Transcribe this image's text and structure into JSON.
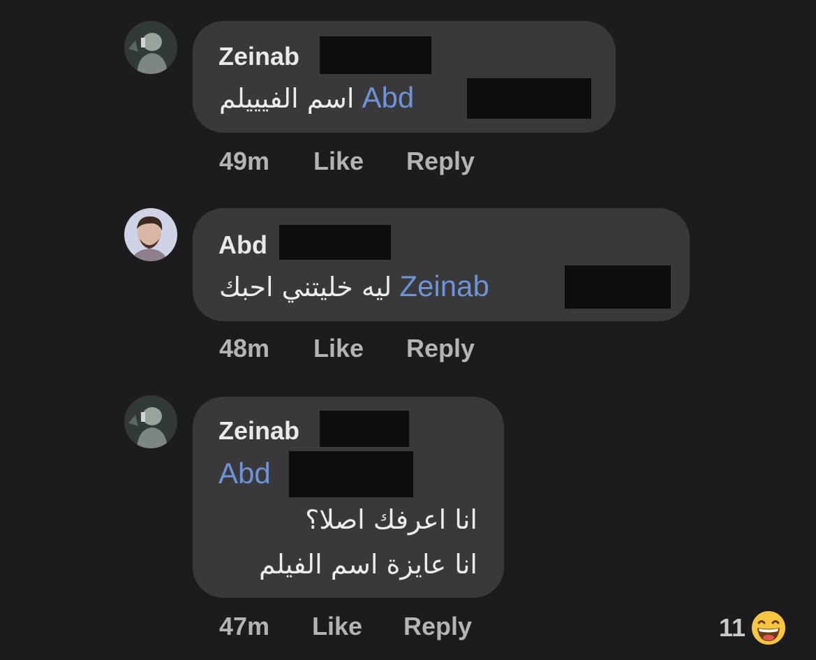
{
  "comments": [
    {
      "author": "Zeinab",
      "mention": "Abd",
      "text": "اسم الفيييلم",
      "time": "49m",
      "like_label": "Like",
      "reply_label": "Reply"
    },
    {
      "author": "Abd",
      "mention": "Zeinab",
      "text": "ليه خليتني احبك",
      "time": "48m",
      "like_label": "Like",
      "reply_label": "Reply"
    },
    {
      "author": "Zeinab",
      "mention": "Abd",
      "lines": [
        "انا اعرفك اصلا؟",
        "انا عايزة اسم الفيلم"
      ],
      "time": "47m",
      "like_label": "Like",
      "reply_label": "Reply",
      "reaction_count": "11",
      "reaction_icon": "laughing-emoji-icon"
    }
  ],
  "colors": {
    "background": "#1c1c1e",
    "bubble": "#39393c",
    "mention": "#6e93d6",
    "redaction": "#0d0d0e"
  }
}
